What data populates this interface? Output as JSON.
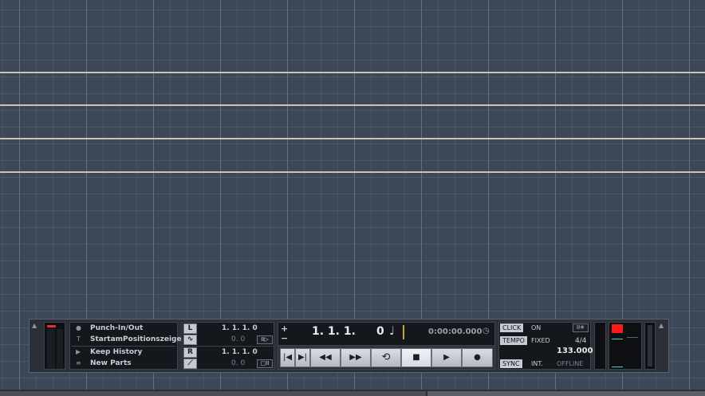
{
  "transport": {
    "options": [
      {
        "icon": "dot-icon",
        "label": "Punch-In/Out"
      },
      {
        "icon": "cursor-icon",
        "label": "StartamPositionszeiger"
      },
      {
        "icon": "play-small-icon",
        "label": "Keep History"
      },
      {
        "icon": "lines-icon",
        "label": "New Parts"
      }
    ],
    "locators": {
      "left_label": "L",
      "left_position": "1. 1. 1.   0",
      "left_offset": "0.   0",
      "right_label": "R",
      "right_position": "1. 1. 1.   0",
      "right_offset": "0.   0"
    },
    "position": {
      "bars_beats": "1. 1. 1.",
      "ticks": "0",
      "time": "0:00:00.000",
      "plus": "+",
      "minus": "−"
    },
    "buttons": [
      {
        "name": "go-to-start-button",
        "glyph": "|◀"
      },
      {
        "name": "go-to-end-button",
        "glyph": "▶|"
      },
      {
        "name": "rewind-button",
        "glyph": "◀◀"
      },
      {
        "name": "fast-forward-button",
        "glyph": "▶▶"
      },
      {
        "name": "cycle-button",
        "glyph": "⟲"
      },
      {
        "name": "stop-button",
        "glyph": "■"
      },
      {
        "name": "play-button",
        "glyph": "▶"
      },
      {
        "name": "record-button",
        "glyph": "●"
      }
    ],
    "click": {
      "label": "CLICK",
      "state": "ON"
    },
    "tempo": {
      "label": "TEMPO",
      "mode": "FIXED",
      "signature": "4/4",
      "bpm": "133.000"
    },
    "sync": {
      "label": "SYNC",
      "source": "INT.",
      "status": "OFFLINE"
    },
    "colors": {
      "record_indicator": "#ff1a1a",
      "meter_line": "#3fd9c8"
    }
  }
}
